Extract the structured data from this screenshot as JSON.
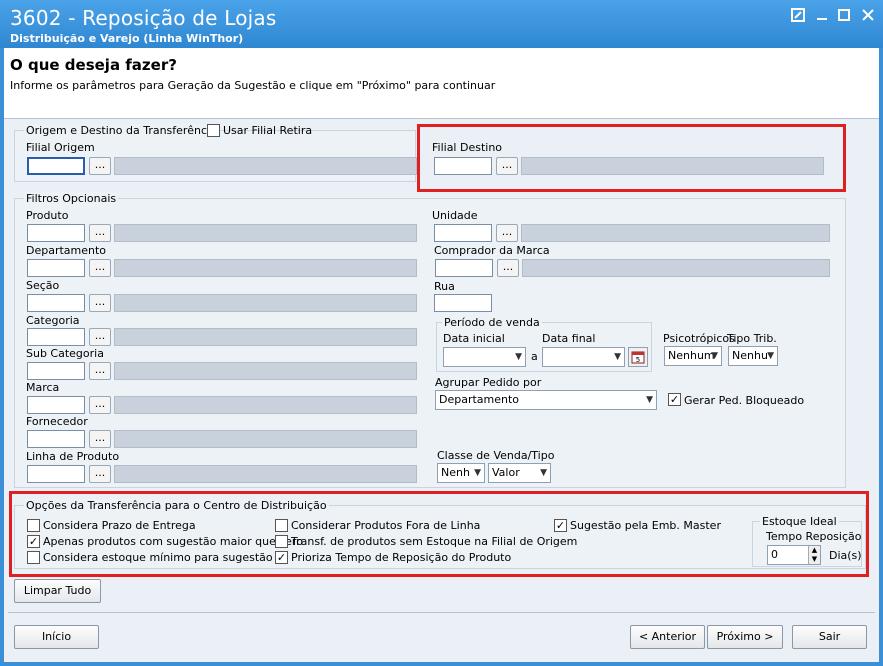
{
  "window": {
    "title": "3602 - Reposição de Lojas",
    "subtitle": "Distribuição e Varejo (Linha WinThor)",
    "help_icon": "help-icon",
    "min_icon": "minimize-icon",
    "max_icon": "maximize-icon",
    "close_icon": "close-icon"
  },
  "header": {
    "title": "O que deseja fazer?",
    "description": "Informe os parâmetros para Geração da Sugestão e clique em \"Próximo\" para continuar"
  },
  "origem": {
    "legend": "Origem e Destino da Transferência",
    "usar_filial_retira": "Usar Filial Retira",
    "filial_origem": "Filial Origem",
    "filial_destino": "Filial Destino",
    "lookup_label": "..."
  },
  "filtros": {
    "legend": "Filtros Opcionais",
    "produto": "Produto",
    "departamento": "Departamento",
    "secao": "Seção",
    "categoria": "Categoria",
    "sub_categoria": "Sub Categoria",
    "marca": "Marca",
    "fornecedor": "Fornecedor",
    "linha_produto": "Linha de Produto",
    "unidade": "Unidade",
    "comprador_marca": "Comprador da Marca",
    "rua": "Rua",
    "periodo_venda": "Período de venda",
    "data_inicial": "Data inicial",
    "data_final": "Data final",
    "a_label": "a",
    "psicotropicos": "Psicotrópicos",
    "psicotropicos_value": "Nenhum",
    "tipo_trib": "Tipo Trib.",
    "tipo_trib_value": "Nenhu",
    "agrupar_pedido": "Agrupar Pedido por",
    "agrupar_pedido_value": "Departamento",
    "gerar_ped_bloqueado": "Gerar Ped. Bloqueado",
    "classe_venda": "Classe de Venda/Tipo",
    "classe_value": "Nenh",
    "tipo_value": "Valor"
  },
  "opcoes": {
    "legend": "Opções da Transferência para o Centro de Distribuição",
    "considera_prazo": "Considera Prazo de Entrega",
    "apenas_sugestao": "Apenas produtos com sugestão maior que zero",
    "considera_estoque_min": "Considera estoque mínimo para sugestão",
    "considerar_fora_linha": "Considerar Produtos Fora de Linha",
    "transf_sem_estoque": "Transf. de produtos sem Estoque na Filial de Origem",
    "prioriza_tempo": "Prioriza Tempo de Reposição do Produto",
    "sugestao_emb_master": "Sugestão pela Emb. Master",
    "estoque_ideal": "Estoque Ideal",
    "tempo_reposicao": "Tempo Reposição",
    "tempo_value": "0",
    "dias": "Dia(s)"
  },
  "buttons": {
    "limpar_tudo": "Limpar Tudo",
    "inicio": "Início",
    "anterior": "< Anterior",
    "proximo": "Próximo >",
    "sair": "Sair"
  }
}
